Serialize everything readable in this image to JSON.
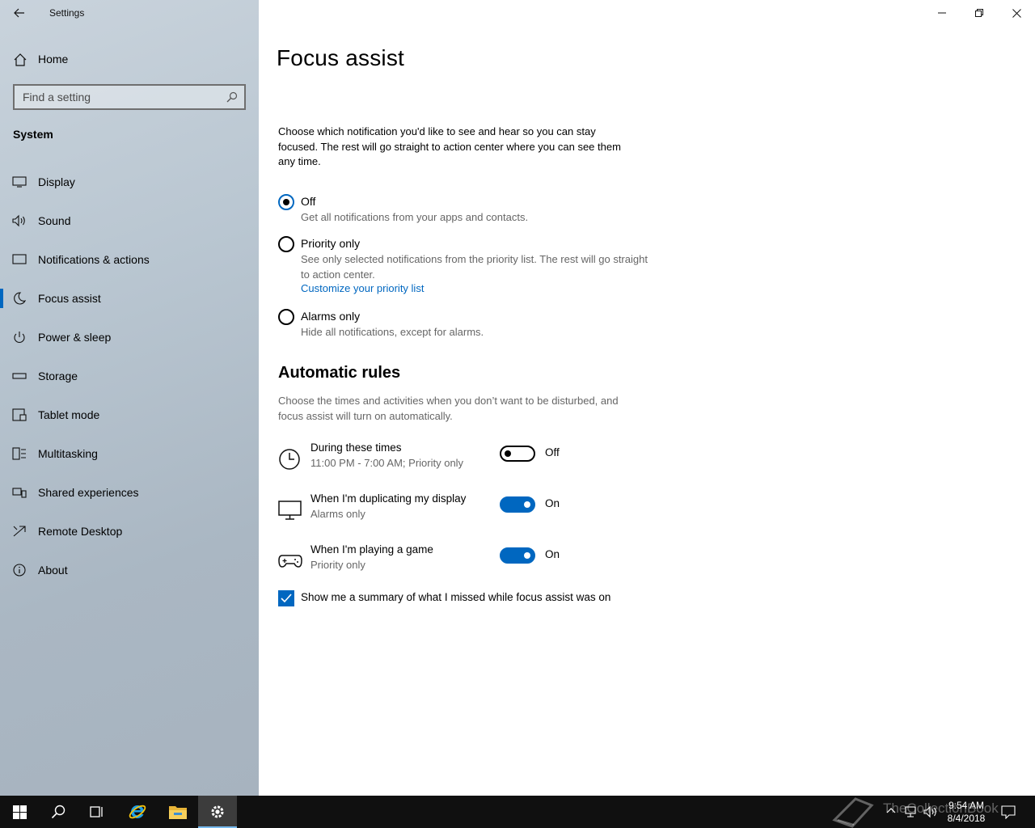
{
  "app": {
    "title": "Settings"
  },
  "sidebar": {
    "home_label": "Home",
    "search_placeholder": "Find a setting",
    "section_label": "System",
    "items": [
      {
        "label": "Display",
        "icon": "display-icon"
      },
      {
        "label": "Sound",
        "icon": "speaker-icon"
      },
      {
        "label": "Notifications & actions",
        "icon": "notification-icon"
      },
      {
        "label": "Focus assist",
        "icon": "moon-icon",
        "active": true
      },
      {
        "label": "Power & sleep",
        "icon": "power-icon"
      },
      {
        "label": "Storage",
        "icon": "storage-icon"
      },
      {
        "label": "Tablet mode",
        "icon": "tablet-icon"
      },
      {
        "label": "Multitasking",
        "icon": "multitasking-icon"
      },
      {
        "label": "Shared experiences",
        "icon": "shared-icon"
      },
      {
        "label": "Remote Desktop",
        "icon": "remote-icon"
      },
      {
        "label": "About",
        "icon": "info-icon"
      }
    ]
  },
  "main": {
    "title": "Focus assist",
    "intro": "Choose which notification you'd like to see and hear so you can stay focused. The rest will go straight to action center where you can see them any time.",
    "options": [
      {
        "label": "Off",
        "description": "Get all notifications from your apps and contacts.",
        "selected": true
      },
      {
        "label": "Priority only",
        "description": "See only selected notifications from the priority list. The rest will go straight to action center.",
        "link": "Customize your priority list",
        "selected": false
      },
      {
        "label": "Alarms only",
        "description": "Hide all notifications, except for alarms.",
        "selected": false
      }
    ],
    "rules_heading": "Automatic rules",
    "rules_description": "Choose the times and activities when you don’t want to be disturbed, and focus assist will turn on automatically.",
    "rules": [
      {
        "title": "During these times",
        "subtitle": "11:00 PM - 7:00 AM; Priority only",
        "state": "Off",
        "icon": "clock-icon"
      },
      {
        "title": "When I'm duplicating my display",
        "subtitle": "Alarms only",
        "state": "On",
        "icon": "monitor-icon"
      },
      {
        "title": "When I'm playing a game",
        "subtitle": "Priority only",
        "state": "On",
        "icon": "gamepad-icon"
      }
    ],
    "summary_label": "Show me a summary of what I missed while focus assist was on",
    "summary_checked": true
  },
  "taskbar": {
    "time": "9:54 AM",
    "date": "8/4/2018",
    "watermark": "TheCollectionBook"
  },
  "colors": {
    "accent": "#0067c0",
    "taskbar": "#101010"
  }
}
